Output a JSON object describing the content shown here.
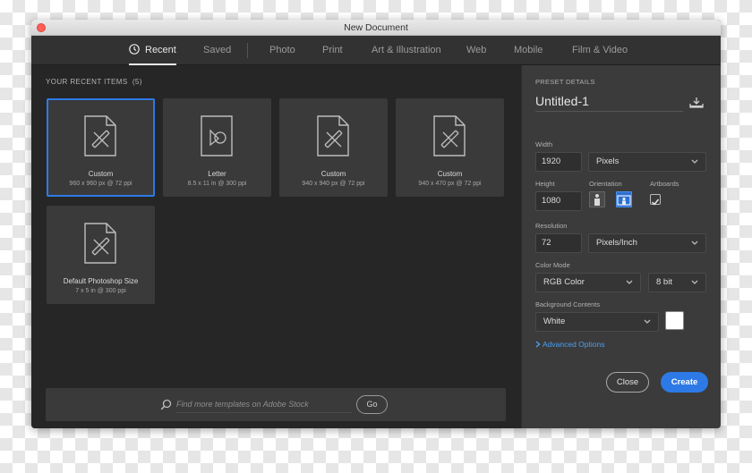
{
  "window": {
    "title": "New Document"
  },
  "tabs": [
    {
      "label": "Recent",
      "active": true
    },
    {
      "label": "Saved"
    },
    {
      "label": "Photo"
    },
    {
      "label": "Print"
    },
    {
      "label": "Art & Illustration"
    },
    {
      "label": "Web"
    },
    {
      "label": "Mobile"
    },
    {
      "label": "Film & Video"
    }
  ],
  "recent": {
    "heading": "YOUR RECENT ITEMS",
    "count": "(5)",
    "items": [
      {
        "name": "Custom",
        "size": "960 x 960 px @ 72 ppi",
        "icon": "brush-document-icon",
        "selected": true
      },
      {
        "name": "Letter",
        "size": "8.5 x 11 in @ 300 ppi",
        "icon": "shapes-document-icon"
      },
      {
        "name": "Custom",
        "size": "940 x 940 px @ 72 ppi",
        "icon": "brush-document-icon"
      },
      {
        "name": "Custom",
        "size": "940 x 470 px @ 72 ppi",
        "icon": "brush-document-icon"
      },
      {
        "name": "Default Photoshop Size",
        "size": "7 x 5 in @ 300 ppi",
        "icon": "brush-document-icon"
      }
    ]
  },
  "stock": {
    "placeholder": "Find more templates on Adobe Stock",
    "go_label": "Go"
  },
  "preset": {
    "heading": "PRESET DETAILS",
    "doc_name": "Untitled-1",
    "width_label": "Width",
    "width_value": "1920",
    "width_unit": "Pixels",
    "height_label": "Height",
    "height_value": "1080",
    "orientation_label": "Orientation",
    "orientation": "landscape",
    "artboards_label": "Artboards",
    "artboards_checked": true,
    "resolution_label": "Resolution",
    "resolution_value": "72",
    "resolution_unit": "Pixels/Inch",
    "color_mode_label": "Color Mode",
    "color_mode": "RGB Color",
    "bit_depth": "8 bit",
    "background_label": "Background Contents",
    "background": "White",
    "background_color": "#ffffff",
    "advanced_label": "Advanced Options"
  },
  "actions": {
    "close_label": "Close",
    "create_label": "Create"
  },
  "colors": {
    "accent": "#2d7ae6",
    "link": "#4a9ff5"
  }
}
